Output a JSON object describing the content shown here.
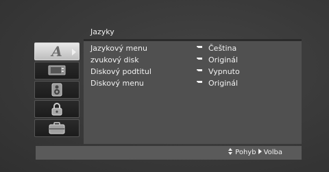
{
  "menu": {
    "title": "Jazyky"
  },
  "sidebar": {
    "tabs": [
      {
        "icon": "language-icon",
        "glyph": "A",
        "active": true
      },
      {
        "icon": "display-icon",
        "active": false
      },
      {
        "icon": "audio-speaker-icon",
        "active": false
      },
      {
        "icon": "lock-icon",
        "active": false
      },
      {
        "icon": "others-briefcase-icon",
        "active": false
      }
    ]
  },
  "settings": [
    {
      "label": "Jazykový menu",
      "value": "Čeština"
    },
    {
      "label": "zvukový disk",
      "value": "Originál"
    },
    {
      "label": "Diskový podtitul",
      "value": "Vypnuto"
    },
    {
      "label": "Diskový menu",
      "value": "Originál"
    }
  ],
  "footer": {
    "move_label": "Pohyb",
    "select_label": "Volba"
  }
}
